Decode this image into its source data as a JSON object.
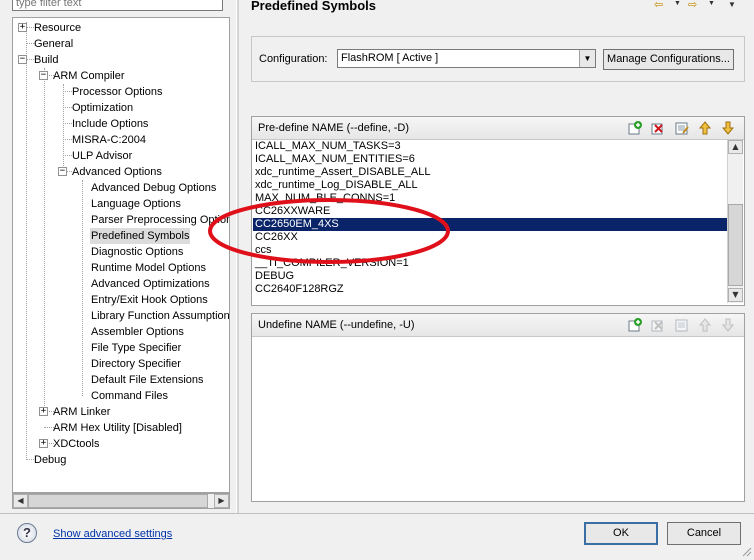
{
  "filter": {
    "placeholder": "type filter text"
  },
  "tree": {
    "items": [
      {
        "label": "Resource"
      },
      {
        "label": "General"
      },
      {
        "label": "Build"
      },
      {
        "label": "ARM Compiler"
      },
      {
        "label": "Processor Options"
      },
      {
        "label": "Optimization"
      },
      {
        "label": "Include Options"
      },
      {
        "label": "MISRA-C:2004"
      },
      {
        "label": "ULP Advisor"
      },
      {
        "label": "Advanced Options"
      },
      {
        "label": "Advanced Debug Options"
      },
      {
        "label": "Language Options"
      },
      {
        "label": "Parser Preprocessing Options"
      },
      {
        "label": "Predefined Symbols"
      },
      {
        "label": "Diagnostic Options"
      },
      {
        "label": "Runtime Model Options"
      },
      {
        "label": "Advanced Optimizations"
      },
      {
        "label": "Entry/Exit Hook Options"
      },
      {
        "label": "Library Function Assumptions"
      },
      {
        "label": "Assembler Options"
      },
      {
        "label": "File Type Specifier"
      },
      {
        "label": "Directory Specifier"
      },
      {
        "label": "Default File Extensions"
      },
      {
        "label": "Command Files"
      },
      {
        "label": "ARM Linker"
      },
      {
        "label": "ARM Hex Utility  [Disabled]"
      },
      {
        "label": "XDCtools"
      },
      {
        "label": "Debug"
      }
    ],
    "selected": "Predefined Symbols"
  },
  "page": {
    "title": "Predefined Symbols"
  },
  "config": {
    "label": "Configuration:",
    "value": "FlashROM  [ Active ]",
    "manage_label": "Manage Configurations..."
  },
  "predefine": {
    "header": "Pre-define NAME (--define, -D)",
    "items": [
      "ICALL_MAX_NUM_TASKS=3",
      "ICALL_MAX_NUM_ENTITIES=6",
      "xdc_runtime_Assert_DISABLE_ALL",
      "xdc_runtime_Log_DISABLE_ALL",
      "MAX_NUM_BLE_CONNS=1",
      "CC26XXWARE",
      "CC2650EM_4XS",
      "CC26XX",
      "ccs",
      "__TI_COMPILER_VERSION=1",
      "DEBUG",
      "CC2640F128RGZ"
    ],
    "selected": "CC2650EM_4XS"
  },
  "undefine": {
    "header": "Undefine NAME (--undefine, -U)"
  },
  "footer": {
    "advanced_link": "Show advanced settings",
    "ok_label": "OK",
    "cancel_label": "Cancel"
  },
  "colors": {
    "selection": "#0a246a",
    "annotation": "#e0101a",
    "link": "#0033aa"
  }
}
